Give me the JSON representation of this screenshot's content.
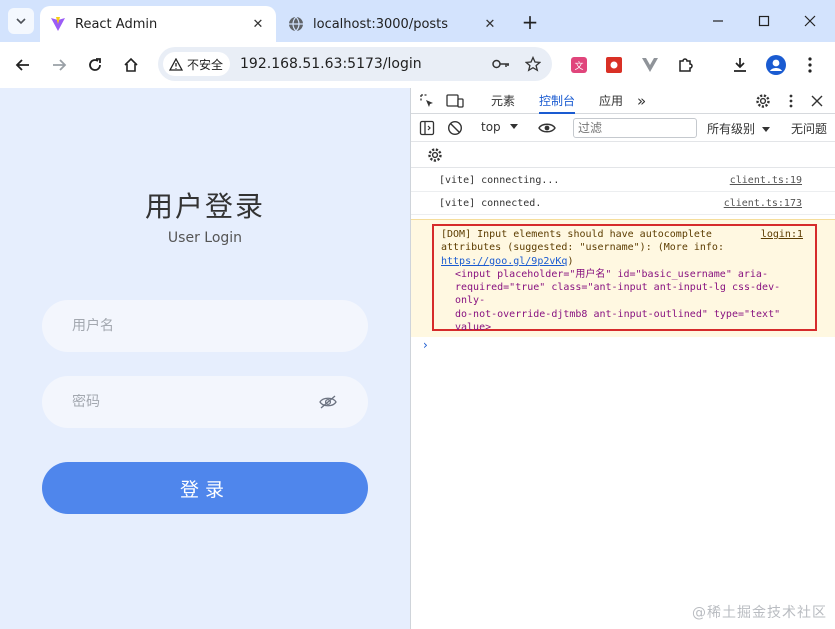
{
  "browser": {
    "tabs": [
      {
        "title": "React Admin",
        "active": true,
        "favicon": "vite-icon"
      },
      {
        "title": "localhost:3000/posts",
        "active": false,
        "favicon": "globe-icon"
      }
    ],
    "new_tab_symbol": "+",
    "security_label": "不安全",
    "url": "192.168.51.63:5173/login"
  },
  "login": {
    "title": "用户登录",
    "subtitle": "User Login",
    "username_placeholder": "用户名",
    "password_placeholder": "密码",
    "submit_label": "登录"
  },
  "devtools": {
    "tabs": [
      "元素",
      "控制台",
      "应用"
    ],
    "active_tab": "控制台",
    "more_tabs": "»",
    "context": "top",
    "filter_placeholder": "过滤",
    "levels": "所有级别",
    "issues": "无问题",
    "messages": [
      {
        "text": "[vite] connecting...",
        "source": "client.ts:19"
      },
      {
        "text": "[vite] connected.",
        "source": "client.ts:173"
      }
    ],
    "warning": {
      "line1": "[DOM] Input elements should have autocomplete",
      "source": "login:1",
      "line2": "attributes (suggested: \"username\"): (More info: ",
      "link": "https://goo.gl/9p2vKq",
      "line2_end": ")",
      "code_lines": [
        "<input placeholder=\"用户名\" id=\"basic_username\" aria-",
        "required=\"true\" class=\"ant-input ant-input-lg css-dev-only-",
        "do-not-override-djtmb8 ant-input-outlined\" type=\"text\"",
        "value>"
      ]
    },
    "prompt_symbol": "›"
  },
  "watermark": "@稀土掘金技术社区",
  "colors": {
    "tabstrip": "#d3e3fd",
    "page_bg": "#e6eefd",
    "login_button": "#4f86ec",
    "devtools_accent": "#1a5bd1",
    "highlight_border": "#d62b2b"
  }
}
